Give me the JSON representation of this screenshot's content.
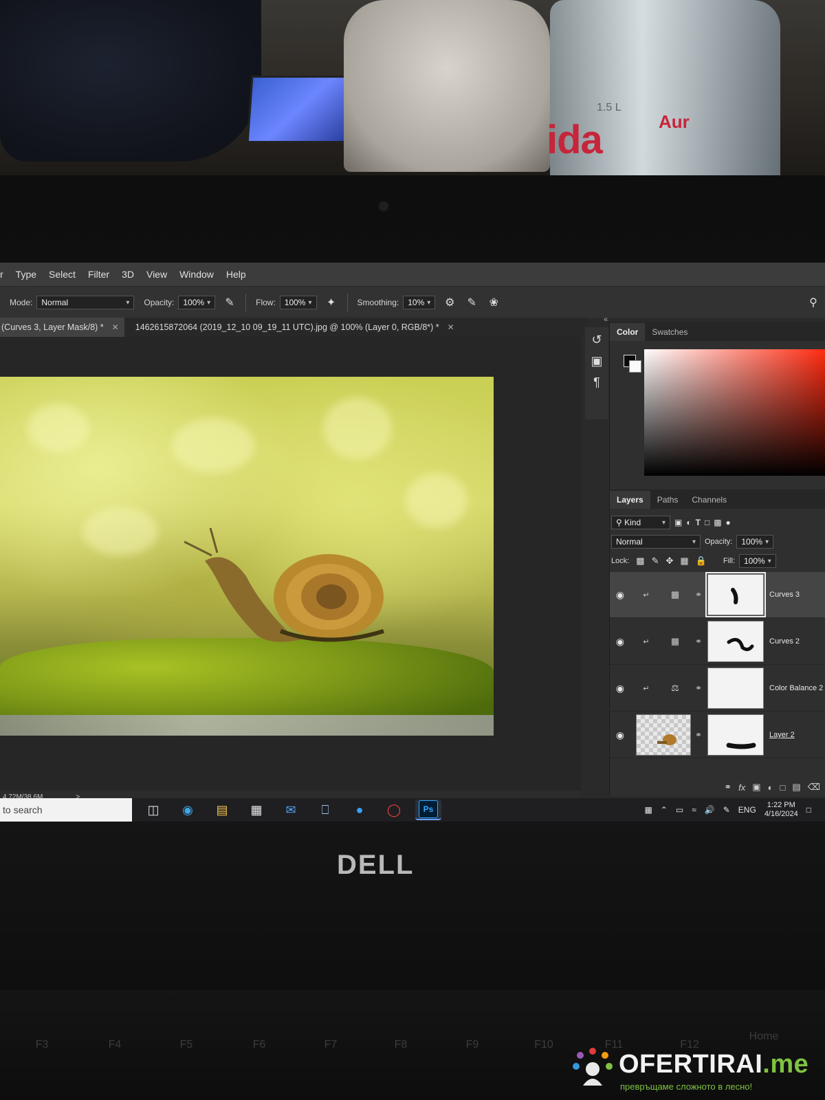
{
  "photo": {
    "bottle_label": "ida",
    "bottle_label2": "Aur",
    "bottle_volume": "1.5 L",
    "laptop_brand": "DELL"
  },
  "menu": [
    "r",
    "Type",
    "Select",
    "Filter",
    "3D",
    "View",
    "Window",
    "Help"
  ],
  "options": {
    "mode_label": "Mode:",
    "mode_value": "Normal",
    "opacity_label": "Opacity:",
    "opacity_value": "100%",
    "flow_label": "Flow:",
    "flow_value": "100%",
    "smoothing_label": "Smoothing:",
    "smoothing_value": "10%"
  },
  "tabs": [
    {
      "label": "(Curves 3, Layer Mask/8) *",
      "active": true
    },
    {
      "label": "1462615872064 (2019_12_10 09_19_11 UTC).jpg @ 100% (Layer 0, RGB/8*) *",
      "active": false
    }
  ],
  "color_panel": {
    "tabs": [
      "Color",
      "Swatches"
    ],
    "foreground": "#0b0b0b",
    "background": "#fafafa",
    "hue": "#ff2a10"
  },
  "layers_panel": {
    "tabs": [
      "Layers",
      "Paths",
      "Channels"
    ],
    "filter_value": "Kind",
    "blend_value": "Normal",
    "opacity_label": "Opacity:",
    "opacity_value": "100%",
    "lock_label": "Lock:",
    "fill_label": "Fill:",
    "fill_value": "100%",
    "layers": [
      {
        "name": "Curves 3",
        "selected": true
      },
      {
        "name": "Curves 2",
        "selected": false
      },
      {
        "name": "Color Balance 2",
        "selected": false
      },
      {
        "name": "Layer 2",
        "selected": false
      }
    ]
  },
  "status": {
    "doc_size": "4.72M/38.6M",
    "arrow": ">"
  },
  "taskbar": {
    "search_placeholder": "to search",
    "language": "ENG",
    "time": "1:22 PM",
    "date": "4/16/2024"
  },
  "keyboard": [
    "F3",
    "F4",
    "F5",
    "F6",
    "F7",
    "F8",
    "F9",
    "F10",
    "F11",
    "F12",
    "Home"
  ],
  "watermark": {
    "brand_main": "OFERTIRAI",
    "brand_tld": ".me",
    "tagline": "превръщаме сложното в лесно!"
  }
}
